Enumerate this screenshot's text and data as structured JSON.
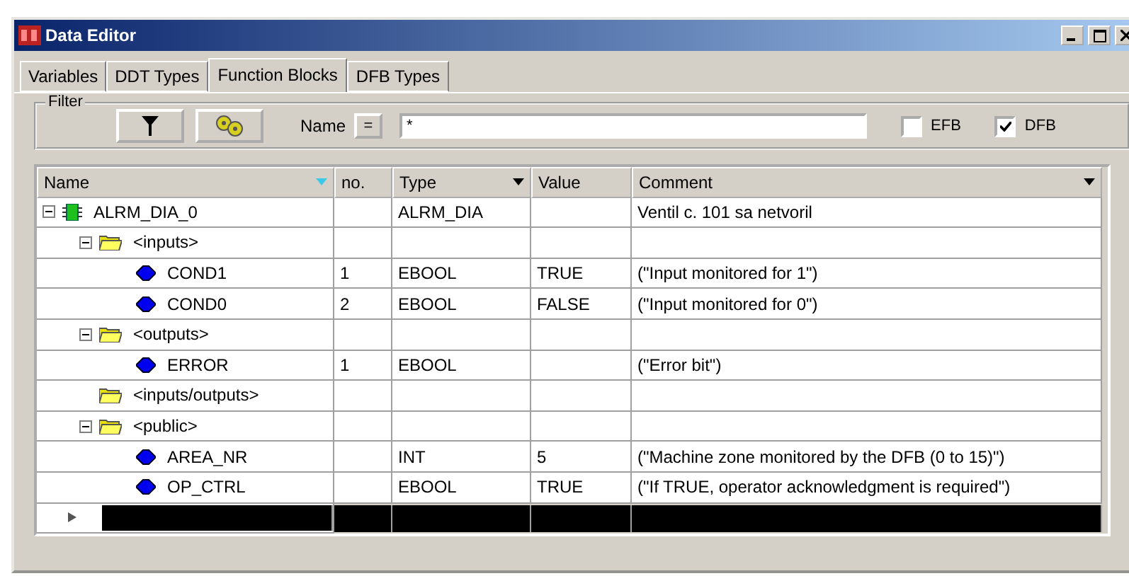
{
  "window": {
    "title": "Data Editor"
  },
  "tabs": [
    {
      "label": "Variables",
      "selected": false
    },
    {
      "label": "DDT Types",
      "selected": false
    },
    {
      "label": "Function Blocks",
      "selected": true
    },
    {
      "label": "DFB Types",
      "selected": false
    }
  ],
  "filter": {
    "title": "Filter",
    "name_label": "Name",
    "operator": "=",
    "value": "*",
    "options": [
      {
        "label": "EFB",
        "checked": false
      },
      {
        "label": "DFB",
        "checked": true
      }
    ]
  },
  "table": {
    "columns": [
      "Name",
      "no.",
      "Type",
      "Value",
      "Comment"
    ],
    "rows": [
      {
        "kind": "block",
        "name": "ALRM_DIA_0",
        "type": "ALRM_DIA",
        "comment": "Ventil c. 101 sa netvoril",
        "expanded": true,
        "children": [
          {
            "kind": "folder",
            "name": "<inputs>",
            "expanded": true,
            "children": [
              {
                "kind": "variable",
                "name": "COND1",
                "no": "1",
                "type": "EBOOL",
                "value": "TRUE",
                "comment": "(\"Input monitored for 1\")"
              },
              {
                "kind": "variable",
                "name": "COND0",
                "no": "2",
                "type": "EBOOL",
                "value": "FALSE",
                "comment": "(\"Input monitored for 0\")"
              }
            ]
          },
          {
            "kind": "folder",
            "name": "<outputs>",
            "expanded": true,
            "children": [
              {
                "kind": "variable",
                "name": "ERROR",
                "no": "1",
                "type": "EBOOL",
                "comment": "(\"Error bit\")"
              }
            ]
          },
          {
            "kind": "folder",
            "name": "<inputs/outputs>"
          },
          {
            "kind": "folder",
            "name": "<public>",
            "expanded": true,
            "children": [
              {
                "kind": "variable",
                "name": "AREA_NR",
                "type": "INT",
                "value": "5",
                "comment": "(\"Machine zone monitored by the DFB (0 to 15)\")"
              },
              {
                "kind": "variable",
                "name": "OP_CTRL",
                "type": "EBOOL",
                "value": "TRUE",
                "comment": "(\"If TRUE, operator acknowledgment is required\")"
              }
            ]
          }
        ]
      }
    ],
    "new_row": {
      "selected": true
    }
  }
}
